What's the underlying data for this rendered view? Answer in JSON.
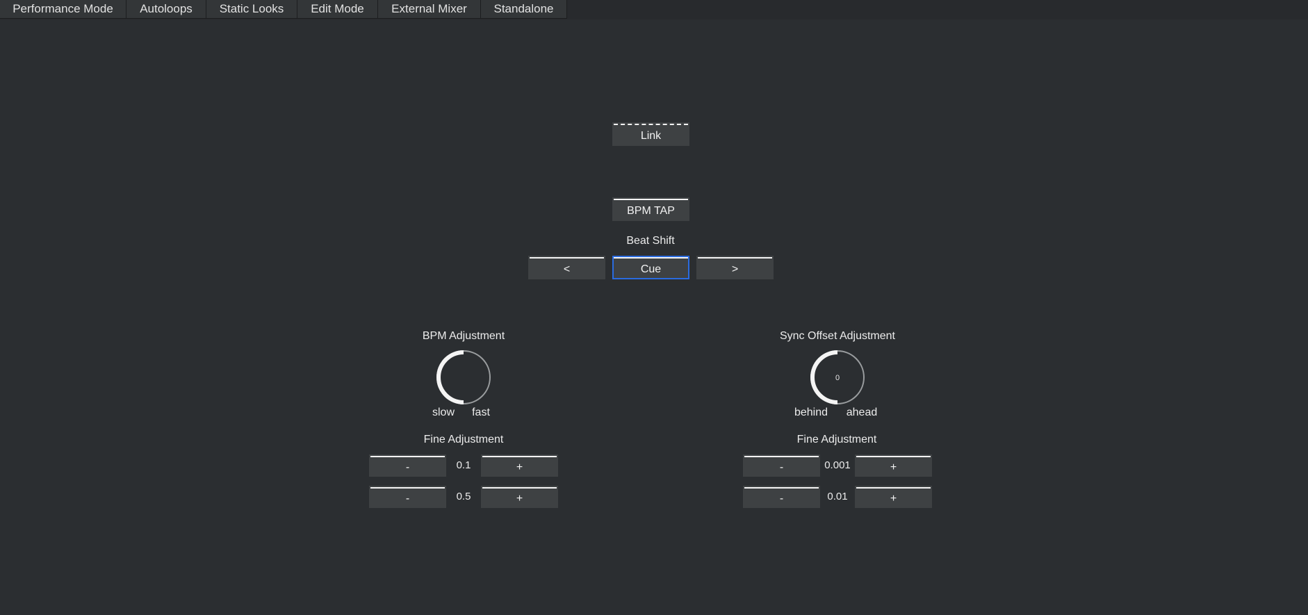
{
  "tabs": [
    {
      "label": "Performance Mode"
    },
    {
      "label": "Autoloops"
    },
    {
      "label": "Static Looks"
    },
    {
      "label": "Edit Mode"
    },
    {
      "label": "External Mixer"
    },
    {
      "label": "Standalone"
    }
  ],
  "sync": {
    "link_label": "Link",
    "bpm_tap_label": "BPM TAP",
    "beat_shift_label": "Beat Shift",
    "beat_shift_back": "<",
    "cue_label": "Cue",
    "beat_shift_forward": ">"
  },
  "bpm_adjustment": {
    "title": "BPM Adjustment",
    "knob_level": 0.5,
    "min_label": "slow",
    "max_label": "fast",
    "fine_title": "Fine Adjustment",
    "rows": [
      {
        "minus": "-",
        "step": "0.1",
        "plus": "+"
      },
      {
        "minus": "-",
        "step": "0.5",
        "plus": "+"
      }
    ]
  },
  "sync_offset_adjustment": {
    "title": "Sync Offset Adjustment",
    "knob_value": "0",
    "knob_level": 0.5,
    "min_label": "behind",
    "max_label": "ahead",
    "fine_title": "Fine Adjustment",
    "rows": [
      {
        "minus": "-",
        "step": "0.001",
        "plus": "+"
      },
      {
        "minus": "-",
        "step": "0.01",
        "plus": "+"
      }
    ]
  },
  "colors": {
    "background": "#2b2e31",
    "button": "#3e4143",
    "selected_border": "#2a6be0",
    "indicator": "#f4f4f4"
  }
}
